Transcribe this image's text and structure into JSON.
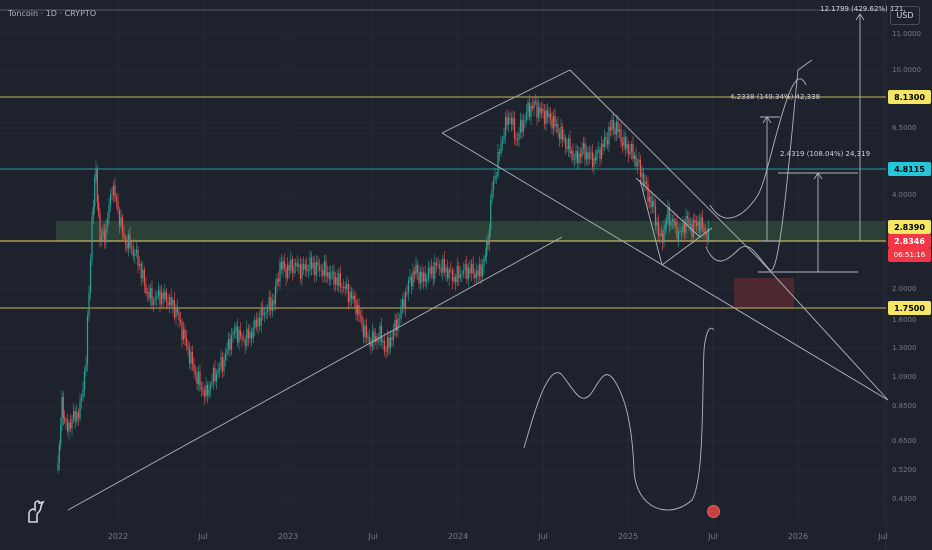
{
  "header": {
    "title": "Toncoin · 1D · CRYPTO",
    "currency": "USD"
  },
  "price_axis": {
    "labels": [
      "11.0000",
      "10.0000",
      "6.5000",
      "4.0000",
      "2.0000",
      "1.6000",
      "1.3000",
      "1.0900",
      "0.8500",
      "0.6500",
      "0.5200",
      "0.4300"
    ]
  },
  "price_tags": {
    "level_1": {
      "text": "8.1300",
      "bg": "#f5e663",
      "fg": "#000000"
    },
    "level_2": {
      "text": "4.8115",
      "bg": "#26c6da",
      "fg": "#000000"
    },
    "level_3": {
      "text": "2.8390",
      "bg": "#f5e663",
      "fg": "#000000"
    },
    "current_price": {
      "text": "2.8346",
      "bg": "#f23645",
      "fg": "#ffffff"
    },
    "countdown": {
      "text": "06:51:16",
      "bg": "#f23645",
      "fg": "#ffffff"
    },
    "level_4": {
      "text": "1.7500",
      "bg": "#f5e663",
      "fg": "#000000"
    }
  },
  "time_axis": {
    "labels": [
      "2022",
      "Jul",
      "2023",
      "Jul",
      "2024",
      "Jul",
      "2025",
      "Jul",
      "2026",
      "Jul"
    ]
  },
  "annotations": {
    "target_top": "12.1799 (429.62%) 121,",
    "target_mid": "4.2338 (149.34%) 42,338",
    "target_low": "2.4319 (108.04%) 24,319"
  },
  "colors": {
    "background": "#1e222d",
    "bull_candle": "#26a69a",
    "bear_candle": "#ef5350",
    "trendline": "#b2b5be",
    "level_line": "#c9b458",
    "cyan_line": "#26c6da"
  }
}
